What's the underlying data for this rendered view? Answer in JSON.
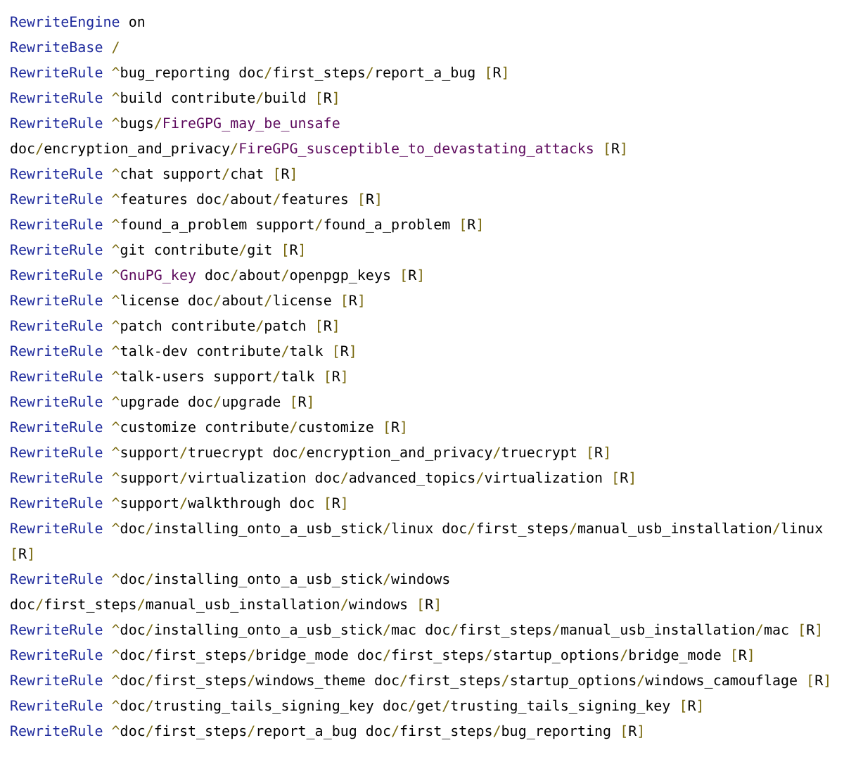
{
  "lines": [
    {
      "keyword": "RewriteEngine",
      "args": [
        {
          "kind": "plain",
          "text": "on"
        }
      ]
    },
    {
      "keyword": "RewriteBase",
      "args": [
        {
          "kind": "plain",
          "text": "/"
        }
      ]
    },
    {
      "keyword": "RewriteRule",
      "args": [
        {
          "kind": "plain",
          "text": "^bug_reporting doc/first_steps/report_a_bug [R]"
        }
      ]
    },
    {
      "keyword": "RewriteRule",
      "args": [
        {
          "kind": "plain",
          "text": "^build contribute/build [R]"
        }
      ]
    },
    {
      "keyword": "RewriteRule",
      "args": [
        {
          "kind": "plain",
          "text": "^bugs/"
        },
        {
          "kind": "name",
          "text": "FireGPG_may_be_unsafe"
        },
        {
          "kind": "plain",
          "text": " doc/encryption_and_privacy/"
        },
        {
          "kind": "name",
          "text": "FireGPG_susceptible_to_devastating_attacks"
        },
        {
          "kind": "plain",
          "text": " [R]"
        }
      ]
    },
    {
      "keyword": "RewriteRule",
      "args": [
        {
          "kind": "plain",
          "text": "^chat support/chat [R]"
        }
      ]
    },
    {
      "keyword": "RewriteRule",
      "args": [
        {
          "kind": "plain",
          "text": "^features doc/about/features [R]"
        }
      ]
    },
    {
      "keyword": "RewriteRule",
      "args": [
        {
          "kind": "plain",
          "text": "^found_a_problem support/found_a_problem [R]"
        }
      ]
    },
    {
      "keyword": "RewriteRule",
      "args": [
        {
          "kind": "plain",
          "text": "^git contribute/git [R]"
        }
      ]
    },
    {
      "keyword": "RewriteRule",
      "args": [
        {
          "kind": "plain",
          "text": "^"
        },
        {
          "kind": "name",
          "text": "GnuPG_key"
        },
        {
          "kind": "plain",
          "text": " doc/about/openpgp_keys [R]"
        }
      ]
    },
    {
      "keyword": "RewriteRule",
      "args": [
        {
          "kind": "plain",
          "text": "^license doc/about/license [R]"
        }
      ]
    },
    {
      "keyword": "RewriteRule",
      "args": [
        {
          "kind": "plain",
          "text": "^patch contribute/patch [R]"
        }
      ]
    },
    {
      "keyword": "RewriteRule",
      "args": [
        {
          "kind": "plain",
          "text": "^talk-dev contribute/talk [R]"
        }
      ]
    },
    {
      "keyword": "RewriteRule",
      "args": [
        {
          "kind": "plain",
          "text": "^talk-users support/talk [R]"
        }
      ]
    },
    {
      "keyword": "RewriteRule",
      "args": [
        {
          "kind": "plain",
          "text": "^upgrade doc/upgrade [R]"
        }
      ]
    },
    {
      "keyword": "RewriteRule",
      "args": [
        {
          "kind": "plain",
          "text": "^customize contribute/customize [R]"
        }
      ]
    },
    {
      "keyword": "RewriteRule",
      "args": [
        {
          "kind": "plain",
          "text": "^support/truecrypt doc/encryption_and_privacy/truecrypt [R]"
        }
      ]
    },
    {
      "keyword": "RewriteRule",
      "args": [
        {
          "kind": "plain",
          "text": "^support/virtualization doc/advanced_topics/virtualization [R]"
        }
      ]
    },
    {
      "keyword": "RewriteRule",
      "args": [
        {
          "kind": "plain",
          "text": "^support/walkthrough doc [R]"
        }
      ]
    },
    {
      "keyword": "RewriteRule",
      "args": [
        {
          "kind": "plain",
          "text": "^doc/installing_onto_a_usb_stick/linux doc/first_steps/manual_usb_installation/linux [R]"
        }
      ]
    },
    {
      "keyword": "RewriteRule",
      "args": [
        {
          "kind": "plain",
          "text": "^doc/installing_onto_a_usb_stick/windows doc/first_steps/manual_usb_installation/windows [R]"
        }
      ]
    },
    {
      "keyword": "RewriteRule",
      "args": [
        {
          "kind": "plain",
          "text": "^doc/installing_onto_a_usb_stick/mac doc/first_steps/manual_usb_installation/mac [R]"
        }
      ]
    },
    {
      "keyword": "RewriteRule",
      "args": [
        {
          "kind": "plain",
          "text": "^doc/first_steps/bridge_mode doc/first_steps/startup_options/bridge_mode [R]"
        }
      ]
    },
    {
      "keyword": "RewriteRule",
      "args": [
        {
          "kind": "plain",
          "text": "^doc/first_steps/windows_theme doc/first_steps/startup_options/windows_camouflage [R]"
        }
      ]
    },
    {
      "keyword": "RewriteRule",
      "args": [
        {
          "kind": "plain",
          "text": "^doc/trusting_tails_signing_key doc/get/trusting_tails_signing_key [R]"
        }
      ]
    },
    {
      "keyword": "RewriteRule",
      "args": [
        {
          "kind": "plain",
          "text": "^doc/first_steps/report_a_bug doc/first_steps/bug_reporting [R]"
        }
      ]
    }
  ]
}
